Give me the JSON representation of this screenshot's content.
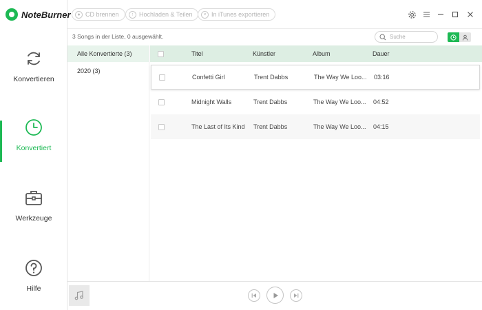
{
  "app": {
    "name": "NoteBurner",
    "brand_color": "#1db954"
  },
  "sidebar": {
    "items": [
      {
        "label": "Konvertieren",
        "icon": "refresh-icon",
        "active": false
      },
      {
        "label": "Konvertiert",
        "icon": "clock-icon",
        "active": true
      },
      {
        "label": "Werkzeuge",
        "icon": "toolbox-icon",
        "active": false
      },
      {
        "label": "Hilfe",
        "icon": "help-icon",
        "active": false
      }
    ]
  },
  "toolbar": {
    "burn_cd": "CD brennen",
    "upload_share": "Hochladen & Teilen",
    "export_itunes": "In iTunes exportieren"
  },
  "list": {
    "status": "3 Songs in der Liste, 0 ausgewählt.",
    "search_placeholder": "Suche"
  },
  "categories": [
    {
      "label": "Alle Konvertierte (3)",
      "selected": true
    },
    {
      "label": "2020 (3)",
      "selected": false
    }
  ],
  "table": {
    "columns": {
      "title": "Titel",
      "artist": "Künstler",
      "album": "Album",
      "duration": "Dauer"
    },
    "rows": [
      {
        "title": "Confetti Girl",
        "artist": "Trent Dabbs",
        "album": "The Way We Loo...",
        "duration": "03:16"
      },
      {
        "title": "Midnight Walls",
        "artist": "Trent Dabbs",
        "album": "The Way We Loo...",
        "duration": "04:52"
      },
      {
        "title": "The Last of Its Kind",
        "artist": "Trent Dabbs",
        "album": "The Way We Loo...",
        "duration": "04:15"
      }
    ]
  }
}
